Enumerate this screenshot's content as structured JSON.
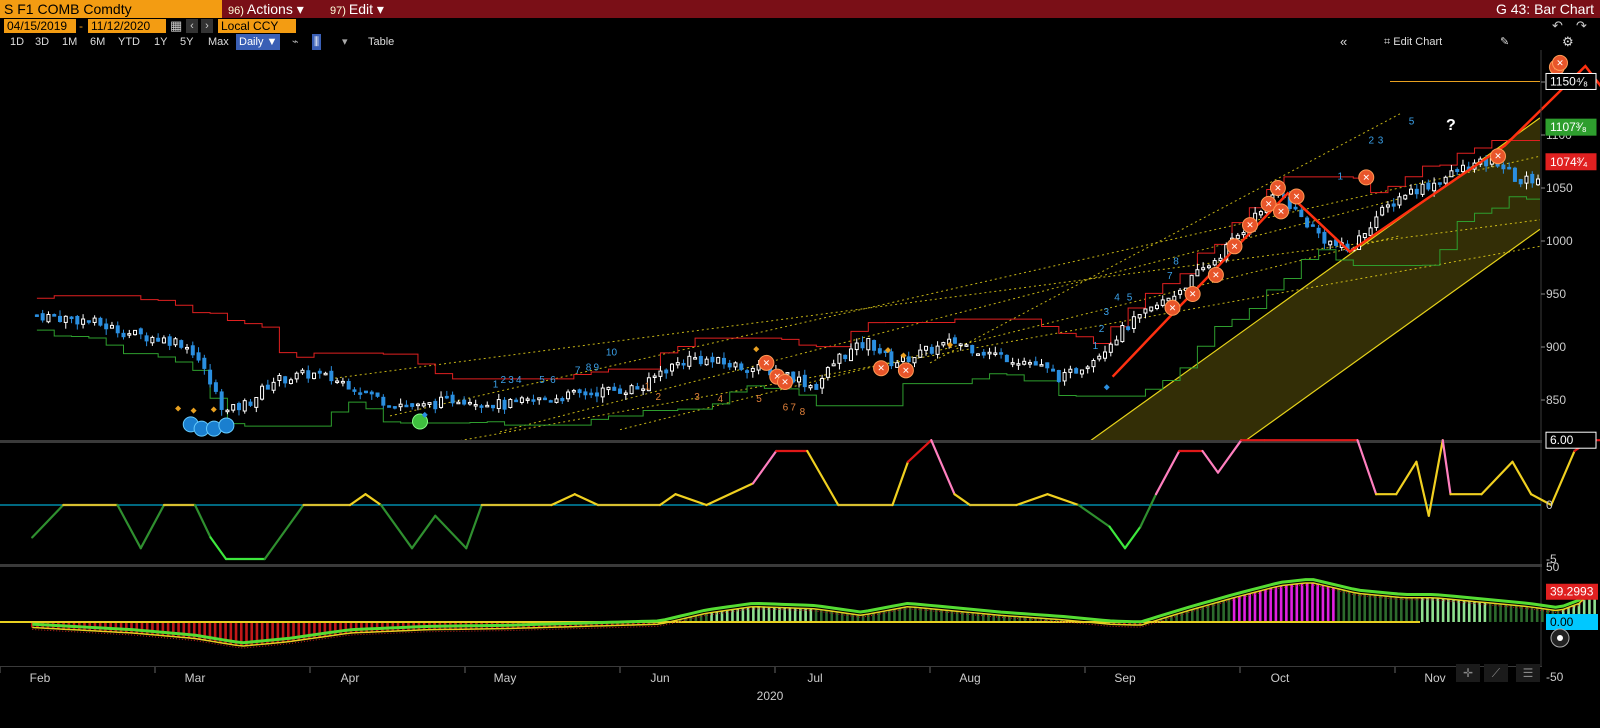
{
  "titlebar": {
    "ticker": "S F1 COMB Comdty",
    "actions": {
      "num": "96)",
      "label": "Actions ▾"
    },
    "edit": {
      "num": "97)",
      "label": "Edit ▾"
    },
    "right": "G 43: Bar Chart"
  },
  "dates": {
    "start": "04/15/2019",
    "end": "11/12/2020",
    "currency": "Local CCY"
  },
  "periods": [
    "1D",
    "3D",
    "1M",
    "6M",
    "YTD",
    "1Y",
    "5Y",
    "Max"
  ],
  "frequency": "Daily ▼",
  "table_label": "Table",
  "edit_chart_label": "Edit Chart",
  "colors": {
    "up": "#ffffff",
    "down": "#2b8fe0",
    "resistance": "#e02020",
    "support": "#2e9e2e",
    "channel": "#e6d21a",
    "zigzag": "#ff3010",
    "hist_pos": "#5fd15f",
    "hist_neg": "#e02020",
    "hist_magenta": "#e020e0",
    "zero_cyan": "#00d0ff"
  },
  "chart_data": [
    {
      "type": "candlestick",
      "ylim": [
        820,
        1180
      ],
      "yticks": [
        850,
        900,
        950,
        1000,
        1050,
        1100,
        1150
      ],
      "yticklabels": [
        "850",
        "900",
        "950",
        "1000",
        "1050",
        "1100",
        "1150"
      ],
      "xticks": [
        "Feb",
        "Mar",
        "Apr",
        "May",
        "Jun",
        "Jul",
        "Aug",
        "Sep",
        "Oct",
        "Nov"
      ],
      "year_label": "2020",
      "price_tags": [
        {
          "label": "1150⁴⁄₈",
          "value": 1150.5,
          "color": "#ffffff"
        },
        {
          "label": "1107³⁄₈",
          "value": 1107.4,
          "color": "#2e9e2e"
        },
        {
          "label": "1074³⁄₄",
          "value": 1074.75,
          "color": "#e02020"
        }
      ],
      "trend_points": [
        {
          "month": 1.0,
          "close": 930
        },
        {
          "month": 1.3,
          "close": 925
        },
        {
          "month": 1.6,
          "close": 912
        },
        {
          "month": 1.9,
          "close": 905
        },
        {
          "month": 2.0,
          "close": 895
        },
        {
          "month": 2.1,
          "close": 865
        },
        {
          "month": 2.2,
          "close": 838
        },
        {
          "month": 2.35,
          "close": 848
        },
        {
          "month": 2.5,
          "close": 868
        },
        {
          "month": 2.75,
          "close": 875
        },
        {
          "month": 3.0,
          "close": 865
        },
        {
          "month": 3.2,
          "close": 850
        },
        {
          "month": 3.45,
          "close": 843
        },
        {
          "month": 3.7,
          "close": 852
        },
        {
          "month": 4.0,
          "close": 845
        },
        {
          "month": 4.3,
          "close": 852
        },
        {
          "month": 4.6,
          "close": 858
        },
        {
          "month": 4.9,
          "close": 862
        },
        {
          "month": 5.0,
          "close": 877
        },
        {
          "month": 5.2,
          "close": 890
        },
        {
          "month": 5.5,
          "close": 882
        },
        {
          "month": 5.8,
          "close": 876
        },
        {
          "month": 6.0,
          "close": 862
        },
        {
          "month": 6.15,
          "close": 890
        },
        {
          "month": 6.35,
          "close": 905
        },
        {
          "month": 6.5,
          "close": 885
        },
        {
          "month": 6.7,
          "close": 895
        },
        {
          "month": 6.9,
          "close": 905
        },
        {
          "month": 7.1,
          "close": 895
        },
        {
          "month": 7.4,
          "close": 885
        },
        {
          "month": 7.6,
          "close": 870
        },
        {
          "month": 7.8,
          "close": 890
        },
        {
          "month": 8.0,
          "close": 918
        },
        {
          "month": 8.3,
          "close": 948
        },
        {
          "month": 8.6,
          "close": 985
        },
        {
          "month": 8.85,
          "close": 1025
        },
        {
          "month": 9.0,
          "close": 1045
        },
        {
          "month": 9.15,
          "close": 1020
        },
        {
          "month": 9.3,
          "close": 1000
        },
        {
          "month": 9.45,
          "close": 990
        },
        {
          "month": 9.6,
          "close": 1020
        },
        {
          "month": 9.8,
          "close": 1045
        },
        {
          "month": 10.0,
          "close": 1055
        },
        {
          "month": 10.2,
          "close": 1070
        },
        {
          "month": 10.4,
          "close": 1075
        },
        {
          "month": 10.55,
          "close": 1055
        },
        {
          "month": 10.7,
          "close": 1062
        },
        {
          "month": 10.8,
          "close": 1085
        },
        {
          "month": 10.9,
          "close": 1110
        },
        {
          "month": 10.97,
          "close": 1140
        },
        {
          "month": 11.0,
          "close": 1150
        }
      ],
      "drawn_annotations": {
        "question_mark": "?"
      },
      "td_count_labels": [
        "1",
        "2",
        "3",
        "4",
        "5",
        "6",
        "7",
        "8",
        "9",
        "10"
      ]
    },
    {
      "type": "line",
      "name": "oscillator",
      "ylim": [
        -8,
        8
      ],
      "yticks": [
        0,
        -5
      ],
      "yticklabels": [
        "0",
        "-5"
      ],
      "last_label": "6.00",
      "last_value": 6.0
    },
    {
      "type": "bar",
      "name": "histogram",
      "ylim": [
        -55,
        60
      ],
      "yticks": [
        50,
        -50
      ],
      "yticklabels": [
        "50",
        "-50"
      ],
      "last_label": "39.2993",
      "last_value": 39.2993,
      "zero_label": "0.00"
    }
  ]
}
